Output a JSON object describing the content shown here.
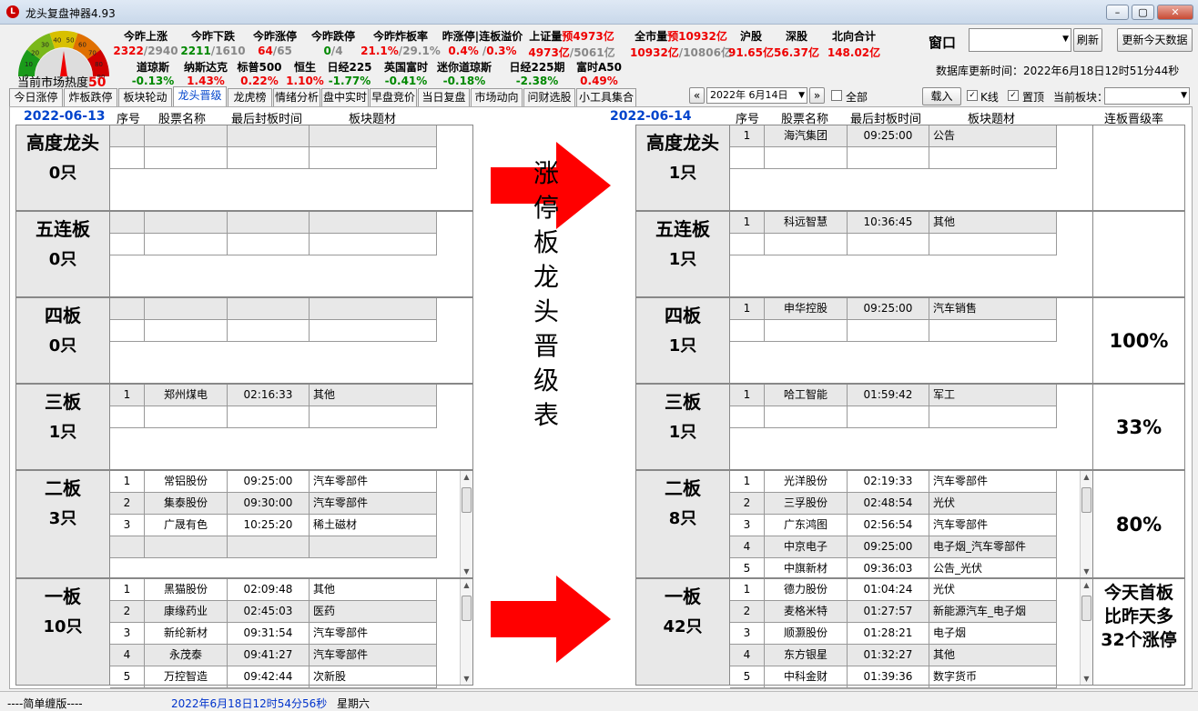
{
  "window": {
    "title": "龙头复盘神器4.93",
    "logo": "L"
  },
  "gauge": {
    "ticks": [
      "0",
      "10",
      "20",
      "30",
      "40",
      "50",
      "60",
      "70",
      "80",
      "90"
    ],
    "value": 50,
    "label": "当前市场热度"
  },
  "indicators_row1": [
    {
      "name": "今昨上涨",
      "v1": "2322",
      "sep": "/",
      "v2": "2940",
      "c1": "red"
    },
    {
      "name": "今昨下跌",
      "v1": "2211",
      "sep": "/",
      "v2": "1610",
      "c1": "green"
    },
    {
      "name": "今昨涨停",
      "v1": "64",
      "sep": "/",
      "v2": "65",
      "c1": "red"
    },
    {
      "name": "今昨跌停",
      "v1": "0",
      "sep": "/",
      "v2": "4",
      "c1": "green"
    },
    {
      "name": "今昨炸板率",
      "v1": "21.1%",
      "sep": "/",
      "v2": "29.1%",
      "c1": "red"
    },
    {
      "name": "昨涨停|连板溢价",
      "v1": "0.4%",
      "sep": " /",
      "v2": "0.3%",
      "c1": "red",
      "c2": "red"
    },
    {
      "name": "上证量",
      "name2": "预4973亿",
      "v1": "4973亿",
      "sep": "/",
      "v2": "5061亿",
      "c1": "red"
    },
    {
      "name": "全市量",
      "name2": "预10932亿",
      "v1": "10932亿",
      "sep": "/",
      "v2": "10806亿",
      "c1": "red"
    },
    {
      "name": "沪股",
      "v1": "91.65亿",
      "c1": "red"
    },
    {
      "name": "深股",
      "v1": "56.37亿",
      "c1": "red"
    },
    {
      "name": "北向合计",
      "v1": "148.02亿",
      "c1": "red"
    }
  ],
  "indicators_row2": [
    {
      "name": "道琼斯",
      "v": "-0.13%",
      "c": "green"
    },
    {
      "name": "纳斯达克",
      "v": "1.43%",
      "c": "red"
    },
    {
      "name": "标普500",
      "v": "0.22%",
      "c": "red"
    },
    {
      "name": "恒生",
      "v": "1.10%",
      "c": "red"
    },
    {
      "name": "日经225",
      "v": "-1.77%",
      "c": "green"
    },
    {
      "name": "英国富时",
      "v": "-0.41%",
      "c": "green"
    },
    {
      "name": "迷你道琼斯",
      "v": "-0.18%",
      "c": "green"
    },
    {
      "name": "日经225期",
      "v": "-2.38%",
      "c": "green"
    },
    {
      "name": "富时A50",
      "v": "0.49%",
      "c": "red"
    }
  ],
  "controls": {
    "window_label": "窗口",
    "refresh": "刷新",
    "update_today": "更新今天数据",
    "db_update": "数据库更新时间：2022年6月18日12时51分44秒",
    "date_value": "2022年  6月14日",
    "all_label": "全部",
    "load": "载入",
    "kline_label": "K线",
    "top_label": "置顶",
    "board_label": "当前板块："
  },
  "tabs": [
    "今日涨停",
    "炸板跌停",
    "板块轮动",
    "龙头晋级",
    "龙虎榜",
    "情绪分析",
    "盘中实时",
    "早盘竞价",
    "当日复盘",
    "市场动向",
    "问财选股",
    "小工具集合"
  ],
  "left": {
    "date": "2022-06-13",
    "headers": [
      "序号",
      "股票名称",
      "最后封板时间",
      "板块题材"
    ],
    "levels": [
      {
        "name": "高度龙头",
        "count": "0只",
        "rows": []
      },
      {
        "name": "五连板",
        "count": "0只",
        "rows": []
      },
      {
        "name": "四板",
        "count": "0只",
        "rows": []
      },
      {
        "name": "三板",
        "count": "1只",
        "rows": [
          [
            "1",
            "郑州煤电",
            "02:16:33",
            "其他"
          ]
        ]
      },
      {
        "name": "二板",
        "count": "3只",
        "rows": [
          [
            "1",
            "常铝股份",
            "09:25:00",
            "汽车零部件"
          ],
          [
            "2",
            "集泰股份",
            "09:30:00",
            "汽车零部件"
          ],
          [
            "3",
            "广晟有色",
            "10:25:20",
            "稀土磁材"
          ]
        ]
      },
      {
        "name": "一板",
        "count": "10只",
        "rows": [
          [
            "1",
            "黑猫股份",
            "02:09:48",
            "其他"
          ],
          [
            "2",
            "康缘药业",
            "02:45:03",
            "医药"
          ],
          [
            "3",
            "新纶新材",
            "09:31:54",
            "汽车零部件"
          ],
          [
            "4",
            "永茂泰",
            "09:41:27",
            "汽车零部件"
          ],
          [
            "5",
            "万控智造",
            "09:42:44",
            "次新股"
          ]
        ]
      }
    ]
  },
  "right": {
    "date": "2022-06-14",
    "headers": [
      "序号",
      "股票名称",
      "最后封板时间",
      "板块题材"
    ],
    "rate_header": "连板晋级率",
    "levels": [
      {
        "name": "高度龙头",
        "count": "1只",
        "rows": [
          [
            "1",
            "海汽集团",
            "09:25:00",
            "公告"
          ]
        ],
        "rate": ""
      },
      {
        "name": "五连板",
        "count": "1只",
        "rows": [
          [
            "1",
            "科远智慧",
            "10:36:45",
            "其他"
          ]
        ],
        "rate": ""
      },
      {
        "name": "四板",
        "count": "1只",
        "rows": [
          [
            "1",
            "申华控股",
            "09:25:00",
            "汽车销售"
          ]
        ],
        "rate": "100%"
      },
      {
        "name": "三板",
        "count": "1只",
        "rows": [
          [
            "1",
            "哈工智能",
            "01:59:42",
            "军工"
          ]
        ],
        "rate": "33%"
      },
      {
        "name": "二板",
        "count": "8只",
        "rows": [
          [
            "1",
            "光洋股份",
            "02:19:33",
            "汽车零部件"
          ],
          [
            "2",
            "三孚股份",
            "02:48:54",
            "光伏"
          ],
          [
            "3",
            "广东鸿图",
            "02:56:54",
            "汽车零部件"
          ],
          [
            "4",
            "中京电子",
            "09:25:00",
            "电子烟_汽车零部件"
          ],
          [
            "5",
            "中旗新材",
            "09:36:03",
            "公告_光伏"
          ]
        ],
        "rate": "80%"
      },
      {
        "name": "一板",
        "count": "42只",
        "rows": [
          [
            "1",
            "德力股份",
            "01:04:24",
            "光伏"
          ],
          [
            "2",
            "麦格米特",
            "01:27:57",
            "新能源汽车_电子烟"
          ],
          [
            "3",
            "顺灏股份",
            "01:28:21",
            "电子烟"
          ],
          [
            "4",
            "东方银星",
            "01:32:27",
            "其他"
          ],
          [
            "5",
            "中科金财",
            "01:39:36",
            "数字货币"
          ]
        ],
        "rate": "今天首板\n比昨天多\n32个涨停"
      }
    ]
  },
  "center_title": [
    "涨",
    "停",
    "板",
    "龙",
    "头",
    "晋",
    "级",
    "表"
  ],
  "status": {
    "edition": "----简单缠版----",
    "datetime": "2022年6月18日12时54分56秒",
    "weekday": "星期六"
  },
  "colors": {
    "accent": "#0044cc",
    "up": "#e00000",
    "down": "#008800",
    "arrow": "#ff0000"
  }
}
